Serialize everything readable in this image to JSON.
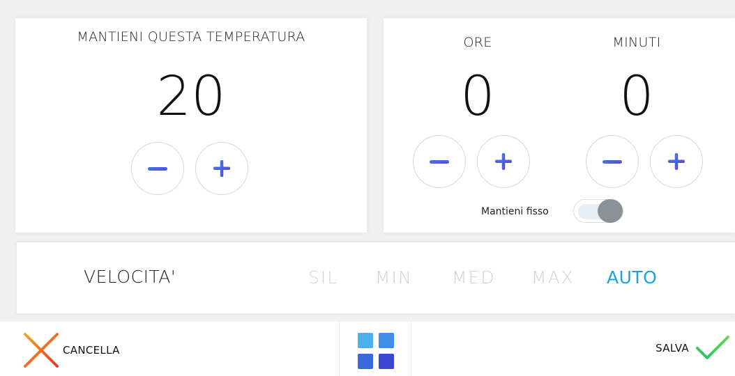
{
  "temperature": {
    "title": "MANTIENI QUESTA TEMPERATURA",
    "value": "20",
    "decrement_icon": "minus-icon",
    "increment_icon": "plus-icon"
  },
  "timer": {
    "hours_title": "ORE",
    "hours_value": "0",
    "minutes_title": "MINUTI",
    "minutes_value": "0",
    "toggle_label": "Mantieni fisso",
    "toggle_state": "off"
  },
  "speed": {
    "label": "VELOCITA'",
    "options": [
      "SIL",
      "MIN",
      "MED",
      "MAX",
      "AUTO"
    ],
    "selected": "AUTO"
  },
  "bottom": {
    "cancel_label": "CANCELLA",
    "save_label": "SALVA",
    "home_icon": "grid-icon"
  },
  "colors": {
    "accent": "#18a2e6",
    "icon_gradient_start": "#2f6ee0",
    "icon_gradient_end": "#5a4fd8",
    "cancel_start": "#f5a623",
    "cancel_end": "#e8342c",
    "save_start": "#29c16d",
    "save_end": "#6ad84a",
    "inactive_option": "#d2d2d2"
  }
}
